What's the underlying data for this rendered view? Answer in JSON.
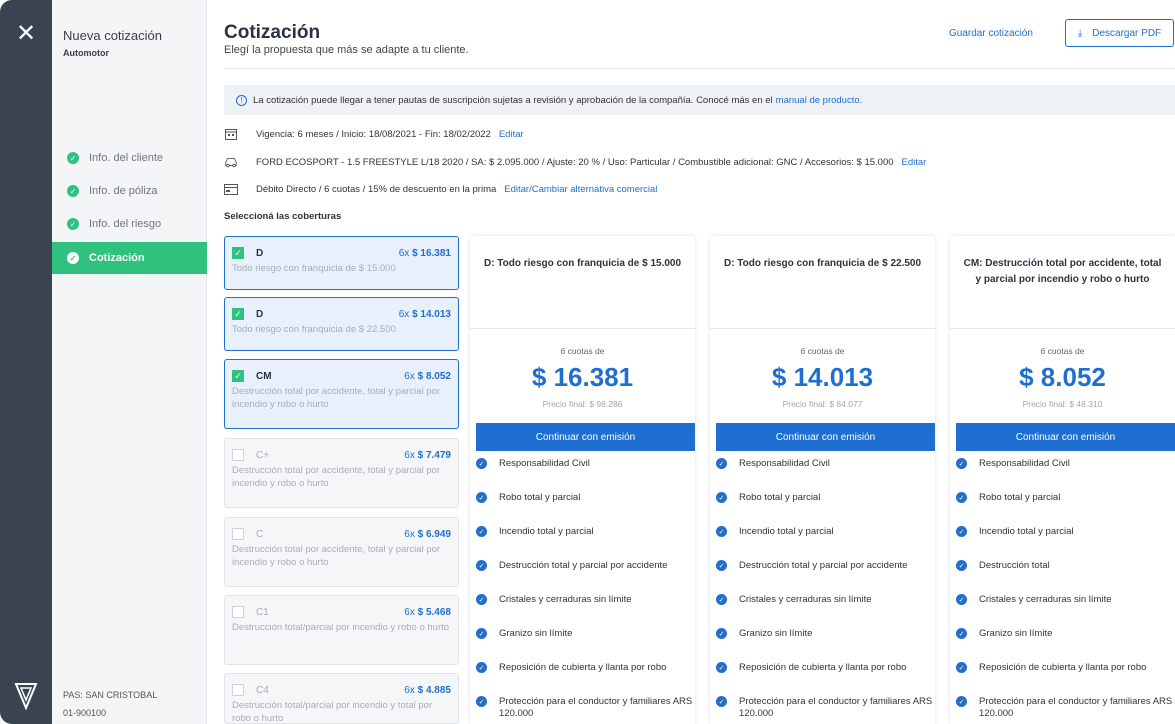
{
  "rail": {
    "close_icon": "close-icon",
    "brand_icon": "brand-logo-icon"
  },
  "sidebar": {
    "title": "Nueva cotización",
    "subtitle": "Automotor",
    "steps": [
      {
        "label": "Info. del cliente",
        "done": true
      },
      {
        "label": "Info. de póliza",
        "done": true
      },
      {
        "label": "Info. del riesgo",
        "done": true
      },
      {
        "label": "Cotización",
        "active": true
      }
    ],
    "footer_pas": "PAS: SAN CRISTOBAL",
    "footer_code": "01-900100"
  },
  "header": {
    "title": "Cotización",
    "subtitle": "Elegí la propuesta que más se adapte a tu cliente.",
    "save_label": "Guardar cotización",
    "pdf_label": "Descargar PDF"
  },
  "notice": {
    "text": "La cotización puede llegar a tener pautas de suscripción sujetas a revisión y aprobación de la compañía. Conocé más en el",
    "link": "manual de producto."
  },
  "info": {
    "vigencia": "Vigencia: 6 meses / Inicio: 18/08/2021 - Fin: 18/02/2022",
    "vigencia_edit": "Editar",
    "vehiculo": "FORD ECOSPORT - 1.5 FREESTYLE L/18 2020 / SA: $ 2.095.000 / Ajuste: 20 % / Uso: Particular / Combustible adicional: GNC / Accesorios: $ 15.000",
    "vehiculo_edit": "Editar",
    "pago": "Débito Directo / 6 cuotas / 15% de descuento en la prima",
    "pago_edit": "Editar/Cambiar alternativa comercial"
  },
  "select_label": "Seleccioná las coberturas",
  "options": [
    {
      "code": "D",
      "prefix": "6x",
      "price": "$ 16.381",
      "desc": "Todo riesgo con franquicia de $ 15.000",
      "selected": true
    },
    {
      "code": "D",
      "prefix": "6x",
      "price": "$ 14.013",
      "desc": "Todo riesgo con franquicia de $ 22.500",
      "selected": true
    },
    {
      "code": "CM",
      "prefix": "6x",
      "price": "$ 8.052",
      "desc": "Destrucción total por accidente, total y parcial por incendio y robo o hurto",
      "selected": true
    },
    {
      "code": "C+",
      "prefix": "6x",
      "price": "$ 7.479",
      "desc": "Destrucción total por accidente, total y parcial por incendio y robo o hurto",
      "selected": false
    },
    {
      "code": "C",
      "prefix": "6x",
      "price": "$ 6.949",
      "desc": "Destrucción total por accidente, total y parcial por incendio y robo o hurto",
      "selected": false
    },
    {
      "code": "C1",
      "prefix": "6x",
      "price": "$ 5.468",
      "desc": "Destrucción total/parcial por incendio y robo o hurto",
      "selected": false
    },
    {
      "code": "C4",
      "prefix": "6x",
      "price": "$ 4.885",
      "desc": "Destrucción total/parcial por incendio y total por robo o hurto",
      "selected": false
    }
  ],
  "plans": [
    {
      "title": "D: Todo riesgo con franquicia de $ 15.000",
      "cuotas": "6 cuotas de",
      "amount": "$ 16.381",
      "final": "Precio final: $ 98.286",
      "button": "Continuar con emisión",
      "features": [
        "Responsabilidad Civil",
        "Robo total y parcial",
        "Incendio total y parcial",
        "Destrucción total y parcial por accidente",
        "Cristales y cerraduras sin límite",
        "Granizo sin límite",
        "Reposición de cubierta y llanta por robo",
        "Protección para el conductor y familiares ARS 120.000"
      ]
    },
    {
      "title": "D: Todo riesgo con franquicia de $ 22.500",
      "cuotas": "6 cuotas de",
      "amount": "$ 14.013",
      "final": "Precio final: $ 84.077",
      "button": "Continuar con emisión",
      "features": [
        "Responsabilidad Civil",
        "Robo total y parcial",
        "Incendio total y parcial",
        "Destrucción total y parcial por accidente",
        "Cristales y cerraduras sin límite",
        "Granizo sin límite",
        "Reposición de cubierta y llanta por robo",
        "Protección para el conductor y familiares ARS 120.000"
      ]
    },
    {
      "title": "CM: Destrucción total por accidente, total y parcial por incendio y robo o hurto",
      "cuotas": "6 cuotas de",
      "amount": "$ 8.052",
      "final": "Precio final: $ 48.310",
      "button": "Continuar con emisión",
      "features": [
        "Responsabilidad Civil",
        "Robo total y parcial",
        "Incendio total y parcial",
        "Destrucción total",
        "Cristales y cerraduras sin límite",
        "Granizo sin límite",
        "Reposición de cubierta y llanta por robo",
        "Protección para el conductor y familiares ARS 120.000"
      ]
    }
  ],
  "colors": {
    "primary": "#1f6fd0",
    "success": "#2ec27e",
    "rail": "#3a4350"
  }
}
